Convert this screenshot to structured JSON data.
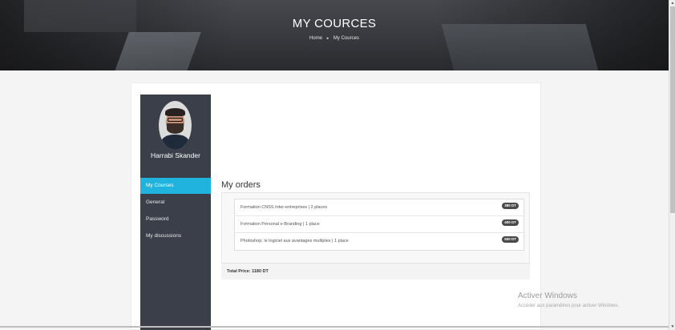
{
  "hero": {
    "title": "MY COURCES",
    "breadcrumb": {
      "home": "Home",
      "separator": "▸",
      "current": "My Cources"
    }
  },
  "sidebar": {
    "user_name": "Harrabi Skander",
    "items": [
      {
        "label": "My Courses",
        "active": true
      },
      {
        "label": "General",
        "active": false
      },
      {
        "label": "Password",
        "active": false
      },
      {
        "label": "My discussions",
        "active": false
      }
    ],
    "bg_color": "#3a3f4a",
    "accent_color": "#1fb3dd"
  },
  "orders": {
    "title": "My orders",
    "rows": [
      {
        "name": "Formation CNSS Inter-entreprises | 2 places",
        "price": "380 DT"
      },
      {
        "name": "Formation Personal e-Branding | 1 place",
        "price": "400 DT"
      },
      {
        "name": "Photoshop, le logiciel aux avantages multiples | 1 place",
        "price": "500 DT"
      }
    ],
    "total": "Total Price: 1180 DT"
  },
  "watermark": {
    "title": "Activer Windows",
    "subtitle": "Accéder aux paramètres pour activer Windows."
  },
  "scrollbar": {
    "up_icon": "▲",
    "down_icon": "▼"
  }
}
